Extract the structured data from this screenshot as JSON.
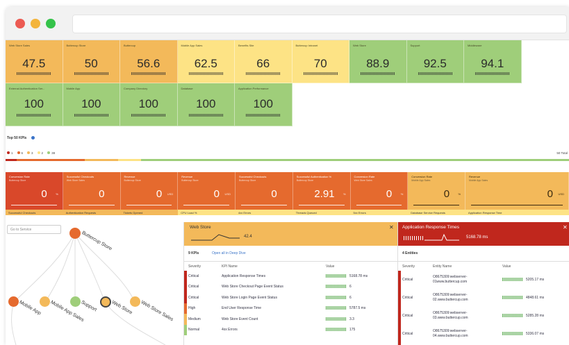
{
  "window": {
    "traffic_lights": [
      "#ec5b53",
      "#f3b43c",
      "#35c34a"
    ]
  },
  "kpi_tiles_row1": [
    {
      "label": "Web Store Sales",
      "value": "47.5",
      "color": "#f3b95a"
    },
    {
      "label": "Buttercup Store",
      "value": "50",
      "color": "#f3b95a"
    },
    {
      "label": "Buttercup",
      "value": "56.6",
      "color": "#f3b95a"
    },
    {
      "label": "Mobile App Sales",
      "value": "62.5",
      "color": "#fde385"
    },
    {
      "label": "Benefits Site",
      "value": "66",
      "color": "#fde385"
    },
    {
      "label": "Buttercup Intranet",
      "value": "70",
      "color": "#fde385"
    },
    {
      "label": "Web Store",
      "value": "88.9",
      "color": "#9fce7a"
    },
    {
      "label": "Support",
      "value": "92.5",
      "color": "#9fce7a"
    },
    {
      "label": "Middleware",
      "value": "94.1",
      "color": "#9fce7a"
    }
  ],
  "kpi_tiles_row2": [
    {
      "label": "External Authentication Ser...",
      "value": "100",
      "color": "#9fce7a"
    },
    {
      "label": "Mobile App",
      "value": "100",
      "color": "#9fce7a"
    },
    {
      "label": "Company Directory",
      "value": "100",
      "color": "#9fce7a"
    },
    {
      "label": "Database",
      "value": "100",
      "color": "#9fce7a"
    },
    {
      "label": "Application Performance",
      "value": "100",
      "color": "#9fce7a"
    }
  ],
  "top_kpis": {
    "title": "Top 50 KPIs",
    "legend": [
      {
        "count": "1",
        "color": "#c0271d"
      },
      {
        "count": "6",
        "color": "#e56a2e"
      },
      {
        "count": "3",
        "color": "#f3b95a"
      },
      {
        "count": "2",
        "color": "#fde385"
      },
      {
        "count": "38",
        "color": "#9fce7a"
      }
    ],
    "total": "50 Total"
  },
  "kpi_cards": [
    {
      "label": "Conversion Rate",
      "sub": "Buttercup Store",
      "value": "0",
      "unit": "%",
      "color": "#d9482a",
      "light": false
    },
    {
      "label": "Successful Checkouts",
      "sub": "Web Store Sales",
      "value": "0",
      "unit": "",
      "color": "#e56a2e",
      "light": false
    },
    {
      "label": "Revenue",
      "sub": "Buttercup Store",
      "value": "0",
      "unit": "USD",
      "color": "#e56a2e",
      "light": false
    },
    {
      "label": "Revenue",
      "sub": "Buttercup Store",
      "value": "0",
      "unit": "USD",
      "color": "#e56a2e",
      "light": false
    },
    {
      "label": "Successful Checkouts",
      "sub": "Buttercup Store",
      "value": "0",
      "unit": "",
      "color": "#e56a2e",
      "light": false
    },
    {
      "label": "Successful Authentication %",
      "sub": "Buttercup Store",
      "value": "2.91",
      "unit": "%",
      "color": "#e56a2e",
      "light": false
    },
    {
      "label": "Conversion Rate",
      "sub": "Web Store Sales",
      "value": "0",
      "unit": "%",
      "color": "#e56a2e",
      "light": false
    },
    {
      "label": "Conversion Rate",
      "sub": "Mobile App Sales",
      "value": "0",
      "unit": "%",
      "color": "#f3b95a",
      "light": true
    },
    {
      "label": "Revenue",
      "sub": "Mobile App Sales",
      "value": "0",
      "unit": "USD",
      "color": "#f3b95a",
      "light": true
    }
  ],
  "kpi_strip": [
    {
      "label": "Successful Checkouts",
      "color": "#f3b95a"
    },
    {
      "label": "Authentication Requests",
      "color": "#f3b95a"
    },
    {
      "label": "Tickets Opened",
      "color": "#f3b95a"
    },
    {
      "label": "CPU Load %",
      "color": "#fde385"
    },
    {
      "label": "4xx Errors",
      "color": "#fde385"
    },
    {
      "label": "Threads Queued",
      "color": "#fde385"
    },
    {
      "label": "5xx Errors",
      "color": "#fde385"
    },
    {
      "label": "Database Service Requests",
      "color": "#fde385"
    },
    {
      "label": "Application Response Time",
      "color": "#fde385"
    }
  ],
  "service_tree": {
    "search_placeholder": "Go to Service",
    "nodes": [
      {
        "label": "Buttercup Store"
      },
      {
        "label": "Mobile App"
      },
      {
        "label": "Mobile App Sales"
      },
      {
        "label": "Support"
      },
      {
        "label": "Web Store"
      },
      {
        "label": "Web Store Sales"
      }
    ]
  },
  "web_store_panel": {
    "title": "Web Store",
    "value": "42.4",
    "kpi_count": "9 KPIs",
    "open_link": "Open all in Deep Dive",
    "columns": [
      "Severity",
      "KPI Name",
      "Value"
    ],
    "rows": [
      {
        "severity": "Critical",
        "name": "Application Response Times",
        "value": "5168.78 ms",
        "sev_color": "#c0271d"
      },
      {
        "severity": "Critical",
        "name": "Web Store Checkout Page Event Status",
        "value": "6",
        "sev_color": "#c0271d"
      },
      {
        "severity": "Critical",
        "name": "Web Store Login Page Event Status",
        "value": "6",
        "sev_color": "#c0271d"
      },
      {
        "severity": "High",
        "name": "End User Response Time",
        "value": "5787.5 ms",
        "sev_color": "#e56a2e"
      },
      {
        "severity": "Medium",
        "name": "Web Store Event Count",
        "value": "3.3",
        "sev_color": "#f3b95a"
      },
      {
        "severity": "Normal",
        "name": "4xx Errors",
        "value": "175",
        "sev_color": "#9fce7a"
      }
    ]
  },
  "response_panel": {
    "title": "Application Response Times",
    "value": "5168.78 ms",
    "entity_count": "4 Entities",
    "columns": [
      "Severity",
      "Entity Name",
      "Value"
    ],
    "rows": [
      {
        "severity": "Critical",
        "name": "O8675309:webserver-01www.buttercup.com",
        "value": "5205.17 ms"
      },
      {
        "severity": "Critical",
        "name": "O8675309:webserver-02.www.buttercup.com",
        "value": "4848.61 ms"
      },
      {
        "severity": "Critical",
        "name": "O8675309:webserver-03.www.buttercup.com",
        "value": "5285.28 ms"
      },
      {
        "severity": "Critical",
        "name": "O8675309:webserver-04.www.buttercup.com",
        "value": "5336.07 ms"
      }
    ]
  }
}
